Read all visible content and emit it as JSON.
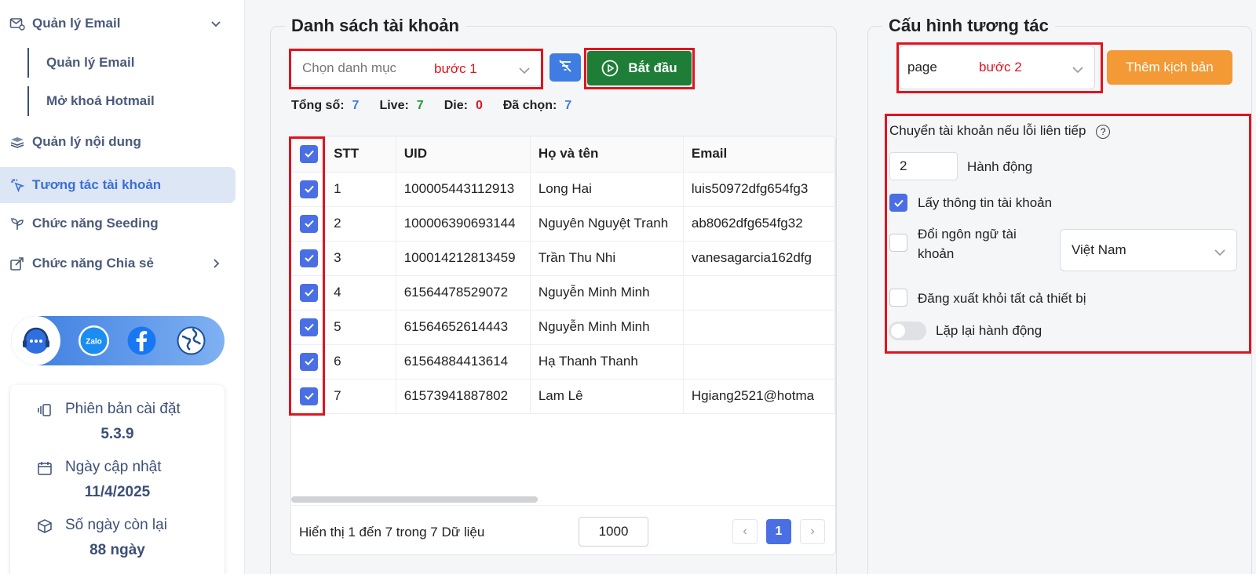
{
  "sidebar": {
    "email_manage": "Quản lý Email",
    "sub_email_manage": "Quản lý Email",
    "sub_unlock_hotmail": "Mở khoá Hotmail",
    "content_manage": "Quản lý nội dung",
    "account_interact": "Tương tác tài khoản",
    "seeding": "Chức năng Seeding",
    "share": "Chức năng Chia sẻ",
    "social_icons": [
      "support-icon",
      "zalo-icon",
      "facebook-icon",
      "globe-icon"
    ],
    "zalo_label": "Zalo",
    "version": {
      "install_label": "Phiên bản cài đặt",
      "install_value": "5.3.9",
      "update_label": "Ngày cập nhật",
      "update_value": "11/4/2025",
      "remaining_label": "Số ngày còn lại",
      "remaining_value": "88 ngày"
    }
  },
  "accounts": {
    "title": "Danh sách tài khoản",
    "category_placeholder": "Chọn danh mục",
    "step1_note": "bước 1",
    "start_button": "Bắt đầu",
    "stats": {
      "total_label": "Tổng số:",
      "total_value": "7",
      "live_label": "Live:",
      "live_value": "7",
      "die_label": "Die:",
      "die_value": "0",
      "selected_label": "Đã chọn:",
      "selected_value": "7"
    },
    "columns": [
      "STT",
      "UID",
      "Họ và tên",
      "Email"
    ],
    "rows": [
      {
        "stt": "1",
        "uid": "100005443112913",
        "name": "Long Hai",
        "email": "luis50972dfg654fg3"
      },
      {
        "stt": "2",
        "uid": "100006390693144",
        "name": "Nguyên Nguyệt Tranh",
        "email": "ab8062dfg654fg32"
      },
      {
        "stt": "3",
        "uid": "100014212813459",
        "name": "Trần Thu Nhi",
        "email": "vanesagarcia162dfg"
      },
      {
        "stt": "4",
        "uid": "61564478529072",
        "name": "Nguyễn Minh Minh",
        "email": ""
      },
      {
        "stt": "5",
        "uid": "61564652614443",
        "name": "Nguyễn Minh Minh",
        "email": ""
      },
      {
        "stt": "6",
        "uid": "61564884413614",
        "name": "Hạ Thanh Thanh",
        "email": ""
      },
      {
        "stt": "7",
        "uid": "61573941887802",
        "name": "Lam Lê",
        "email": "Hgiang2521@hotma"
      }
    ],
    "footer_info": "Hiển thị 1 đến 7 trong 7 Dữ liệu",
    "page_size": "1000",
    "current_page": "1",
    "prev": "‹",
    "next": "›"
  },
  "config": {
    "title": "Cấu hình tương tác",
    "page_value": "page",
    "step2_note": "bước 2",
    "add_script_button": "Thêm kịch bản",
    "switch_label": "Chuyển tài khoản nếu lỗi liên tiếp",
    "help": "?",
    "action_count": "2",
    "action_label": "Hành động",
    "get_info_label": "Lấy thông tin tài khoản",
    "change_lang_label_1": "Đổi ngôn ngữ tài",
    "change_lang_label_2": "khoản",
    "language_value": "Việt Nam",
    "logout_all_label": "Đăng xuất khỏi tất cả thiết bị",
    "repeat_label": "Lặp lại hành động"
  },
  "colors": {
    "accent": "#3f7de2",
    "start_green": "#1e7e37",
    "orange": "#f39a36",
    "annotation_red": "#e0141e",
    "live_green": "#1e9a3a",
    "die_red": "#e0141e",
    "stat_blue": "#3f7de2"
  }
}
